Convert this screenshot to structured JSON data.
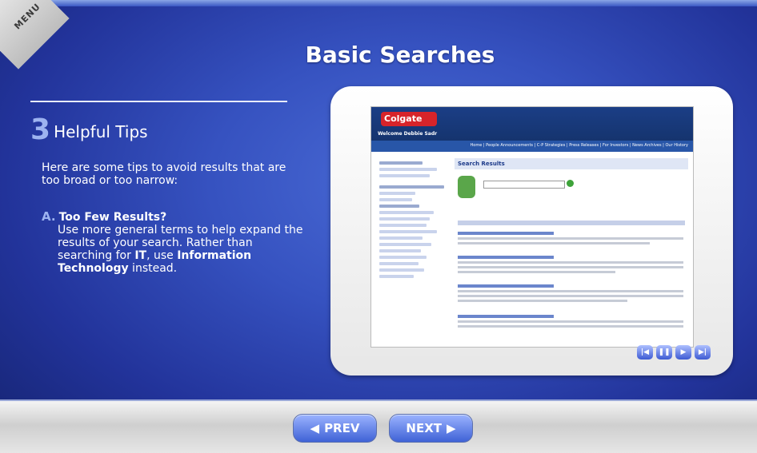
{
  "menu": {
    "label": "MENU"
  },
  "slide": {
    "title": "Basic Searches"
  },
  "section": {
    "number": "3",
    "label": "Helpful Tips"
  },
  "intro": "Here are some tips to avoid results that are too broad or too narrow:",
  "tips": [
    {
      "letter": "A.",
      "heading": "Too Few Results?",
      "body_before": "Use more general terms to help expand the results of your search. Rather than searching for ",
      "term1": "IT",
      "body_middle": ", use ",
      "term2": "Information Technology",
      "body_after": " instead."
    }
  ],
  "screenshot": {
    "logo": "Colgate",
    "welcome": "Welcome Debbie Sadr",
    "nav_links": "Home | People Announcements | C-P Strategies | Press Releases | For Investors | News Archives | Our History",
    "results_heading": "Search Results"
  },
  "player_controls": [
    {
      "name": "rewind-icon",
      "glyph": "|◀"
    },
    {
      "name": "pause-icon",
      "glyph": "❚❚"
    },
    {
      "name": "play-icon",
      "glyph": "▶"
    },
    {
      "name": "end-icon",
      "glyph": "▶|"
    }
  ],
  "nav": {
    "prev": "PREV",
    "next": "NEXT"
  },
  "colors": {
    "accent": "#9db3f0",
    "background": "#3652c0",
    "button": "#3f62d6"
  }
}
